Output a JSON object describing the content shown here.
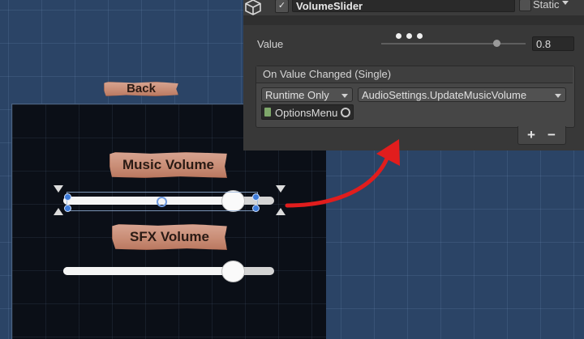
{
  "scene": {
    "back_label": "Back",
    "music_label": "Music Volume",
    "sfx_label": "SFX Volume",
    "music_slider_value": 0.8,
    "sfx_slider_value": 0.8
  },
  "inspector": {
    "object_name": "VolumeSlider",
    "active_checked": true,
    "checkmark": "✓",
    "static_label": "Static",
    "value_label": "Value",
    "value": "0.8",
    "slider_value": 0.8,
    "event_title": "On Value Changed (Single)",
    "runtime_option": "Runtime Only",
    "function_option": "AudioSettings.UpdateMusicVolume",
    "target_object": "OptionsMenu",
    "add_label": "+",
    "remove_label": "−"
  },
  "colors": {
    "wood": "#c98d76",
    "arrow": "#e11d1d",
    "scene_bg": "#2b4466",
    "panel_bg": "#0b0f17",
    "inspector_bg": "#383838"
  },
  "icons": [
    "cube-icon",
    "script-icon",
    "object-picker-icon"
  ]
}
